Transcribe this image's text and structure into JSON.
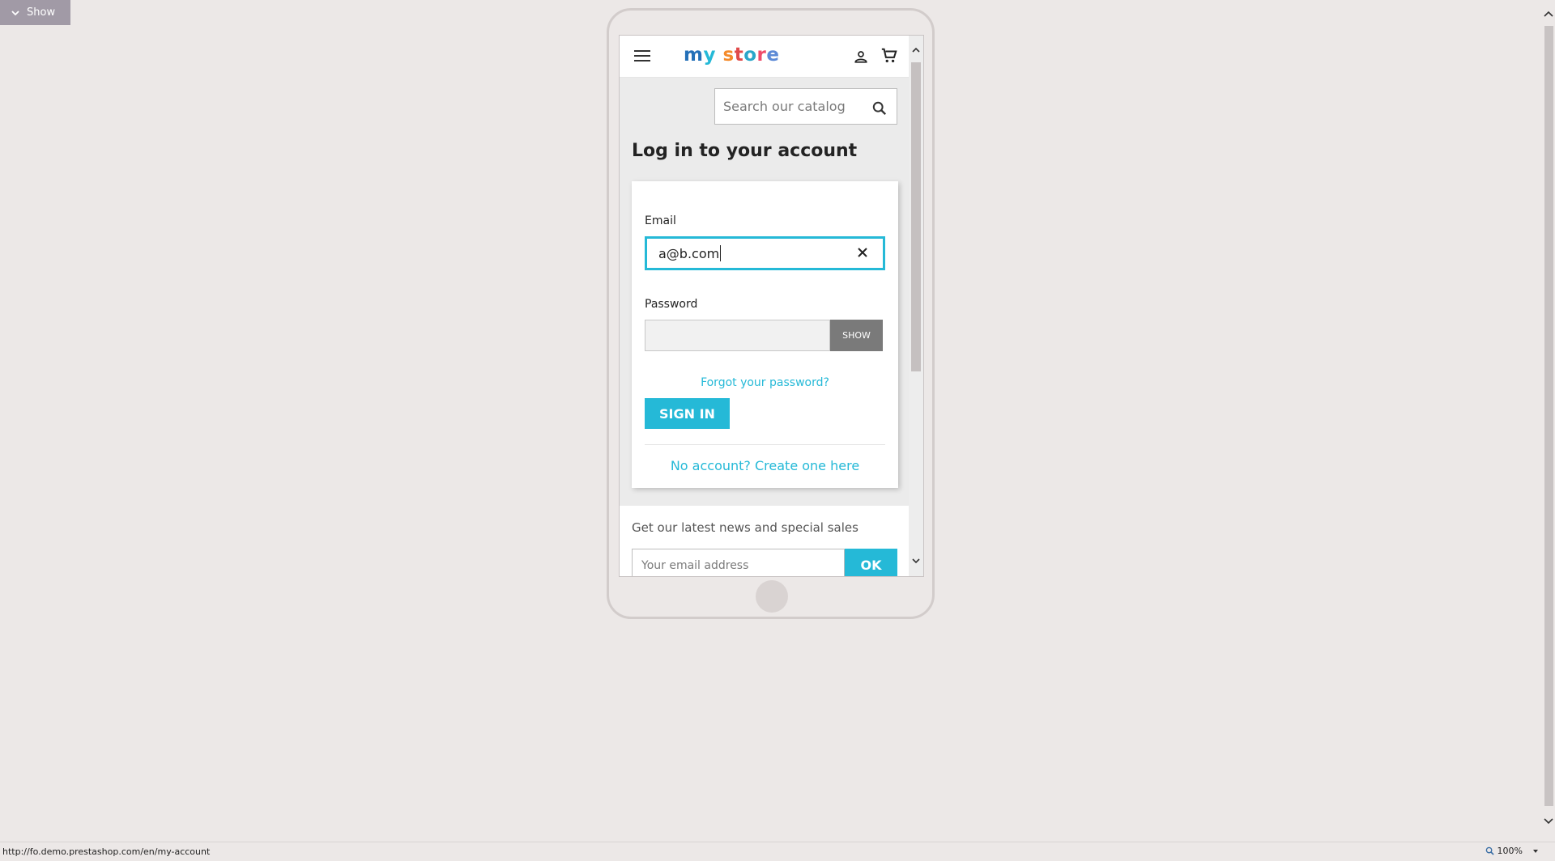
{
  "toggle": {
    "label": "Show"
  },
  "header": {
    "logo": {
      "part1": "my",
      "part2": "store"
    }
  },
  "search": {
    "placeholder": "Search our catalog"
  },
  "page": {
    "title": "Log in to your account"
  },
  "login": {
    "email_label": "Email",
    "email_value": "a@b.com",
    "password_label": "Password",
    "show_label": "SHOW",
    "forgot_label": "Forgot your password?",
    "signin_label": "SIGN IN",
    "create_label": "No account? Create one here"
  },
  "newsletter": {
    "text": "Get our latest news and special sales",
    "placeholder": "Your email address",
    "ok_label": "OK"
  },
  "status_bar": {
    "url": "http://fo.demo.prestashop.com/en/my-account",
    "zoom": "100%"
  },
  "colors": {
    "accent": "#25b9d7",
    "background": "#ece8e7",
    "show_button": "#7a7a7a"
  },
  "icons": [
    "chevron-down-icon",
    "menu-icon",
    "user-icon",
    "cart-icon",
    "search-icon",
    "close-icon",
    "magnifier-icon"
  ]
}
